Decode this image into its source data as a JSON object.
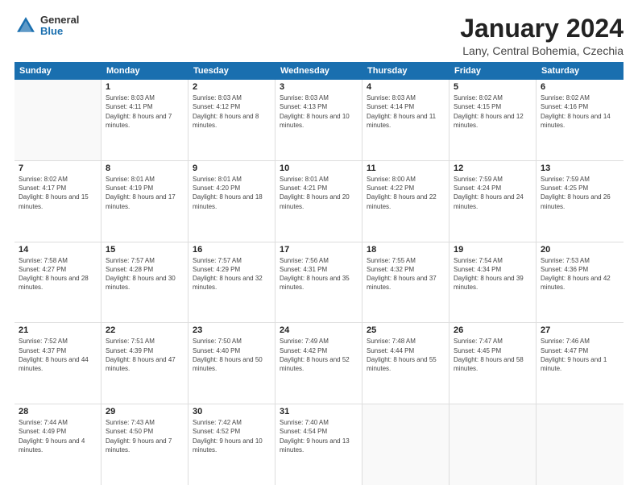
{
  "header": {
    "logo": {
      "general": "General",
      "blue": "Blue"
    },
    "title": "January 2024",
    "location": "Lany, Central Bohemia, Czechia"
  },
  "weekdays": [
    "Sunday",
    "Monday",
    "Tuesday",
    "Wednesday",
    "Thursday",
    "Friday",
    "Saturday"
  ],
  "weeks": [
    [
      {
        "day": "",
        "sunrise": "",
        "sunset": "",
        "daylight": ""
      },
      {
        "day": "1",
        "sunrise": "Sunrise: 8:03 AM",
        "sunset": "Sunset: 4:11 PM",
        "daylight": "Daylight: 8 hours and 7 minutes."
      },
      {
        "day": "2",
        "sunrise": "Sunrise: 8:03 AM",
        "sunset": "Sunset: 4:12 PM",
        "daylight": "Daylight: 8 hours and 8 minutes."
      },
      {
        "day": "3",
        "sunrise": "Sunrise: 8:03 AM",
        "sunset": "Sunset: 4:13 PM",
        "daylight": "Daylight: 8 hours and 10 minutes."
      },
      {
        "day": "4",
        "sunrise": "Sunrise: 8:03 AM",
        "sunset": "Sunset: 4:14 PM",
        "daylight": "Daylight: 8 hours and 11 minutes."
      },
      {
        "day": "5",
        "sunrise": "Sunrise: 8:02 AM",
        "sunset": "Sunset: 4:15 PM",
        "daylight": "Daylight: 8 hours and 12 minutes."
      },
      {
        "day": "6",
        "sunrise": "Sunrise: 8:02 AM",
        "sunset": "Sunset: 4:16 PM",
        "daylight": "Daylight: 8 hours and 14 minutes."
      }
    ],
    [
      {
        "day": "7",
        "sunrise": "Sunrise: 8:02 AM",
        "sunset": "Sunset: 4:17 PM",
        "daylight": "Daylight: 8 hours and 15 minutes."
      },
      {
        "day": "8",
        "sunrise": "Sunrise: 8:01 AM",
        "sunset": "Sunset: 4:19 PM",
        "daylight": "Daylight: 8 hours and 17 minutes."
      },
      {
        "day": "9",
        "sunrise": "Sunrise: 8:01 AM",
        "sunset": "Sunset: 4:20 PM",
        "daylight": "Daylight: 8 hours and 18 minutes."
      },
      {
        "day": "10",
        "sunrise": "Sunrise: 8:01 AM",
        "sunset": "Sunset: 4:21 PM",
        "daylight": "Daylight: 8 hours and 20 minutes."
      },
      {
        "day": "11",
        "sunrise": "Sunrise: 8:00 AM",
        "sunset": "Sunset: 4:22 PM",
        "daylight": "Daylight: 8 hours and 22 minutes."
      },
      {
        "day": "12",
        "sunrise": "Sunrise: 7:59 AM",
        "sunset": "Sunset: 4:24 PM",
        "daylight": "Daylight: 8 hours and 24 minutes."
      },
      {
        "day": "13",
        "sunrise": "Sunrise: 7:59 AM",
        "sunset": "Sunset: 4:25 PM",
        "daylight": "Daylight: 8 hours and 26 minutes."
      }
    ],
    [
      {
        "day": "14",
        "sunrise": "Sunrise: 7:58 AM",
        "sunset": "Sunset: 4:27 PM",
        "daylight": "Daylight: 8 hours and 28 minutes."
      },
      {
        "day": "15",
        "sunrise": "Sunrise: 7:57 AM",
        "sunset": "Sunset: 4:28 PM",
        "daylight": "Daylight: 8 hours and 30 minutes."
      },
      {
        "day": "16",
        "sunrise": "Sunrise: 7:57 AM",
        "sunset": "Sunset: 4:29 PM",
        "daylight": "Daylight: 8 hours and 32 minutes."
      },
      {
        "day": "17",
        "sunrise": "Sunrise: 7:56 AM",
        "sunset": "Sunset: 4:31 PM",
        "daylight": "Daylight: 8 hours and 35 minutes."
      },
      {
        "day": "18",
        "sunrise": "Sunrise: 7:55 AM",
        "sunset": "Sunset: 4:32 PM",
        "daylight": "Daylight: 8 hours and 37 minutes."
      },
      {
        "day": "19",
        "sunrise": "Sunrise: 7:54 AM",
        "sunset": "Sunset: 4:34 PM",
        "daylight": "Daylight: 8 hours and 39 minutes."
      },
      {
        "day": "20",
        "sunrise": "Sunrise: 7:53 AM",
        "sunset": "Sunset: 4:36 PM",
        "daylight": "Daylight: 8 hours and 42 minutes."
      }
    ],
    [
      {
        "day": "21",
        "sunrise": "Sunrise: 7:52 AM",
        "sunset": "Sunset: 4:37 PM",
        "daylight": "Daylight: 8 hours and 44 minutes."
      },
      {
        "day": "22",
        "sunrise": "Sunrise: 7:51 AM",
        "sunset": "Sunset: 4:39 PM",
        "daylight": "Daylight: 8 hours and 47 minutes."
      },
      {
        "day": "23",
        "sunrise": "Sunrise: 7:50 AM",
        "sunset": "Sunset: 4:40 PM",
        "daylight": "Daylight: 8 hours and 50 minutes."
      },
      {
        "day": "24",
        "sunrise": "Sunrise: 7:49 AM",
        "sunset": "Sunset: 4:42 PM",
        "daylight": "Daylight: 8 hours and 52 minutes."
      },
      {
        "day": "25",
        "sunrise": "Sunrise: 7:48 AM",
        "sunset": "Sunset: 4:44 PM",
        "daylight": "Daylight: 8 hours and 55 minutes."
      },
      {
        "day": "26",
        "sunrise": "Sunrise: 7:47 AM",
        "sunset": "Sunset: 4:45 PM",
        "daylight": "Daylight: 8 hours and 58 minutes."
      },
      {
        "day": "27",
        "sunrise": "Sunrise: 7:46 AM",
        "sunset": "Sunset: 4:47 PM",
        "daylight": "Daylight: 9 hours and 1 minute."
      }
    ],
    [
      {
        "day": "28",
        "sunrise": "Sunrise: 7:44 AM",
        "sunset": "Sunset: 4:49 PM",
        "daylight": "Daylight: 9 hours and 4 minutes."
      },
      {
        "day": "29",
        "sunrise": "Sunrise: 7:43 AM",
        "sunset": "Sunset: 4:50 PM",
        "daylight": "Daylight: 9 hours and 7 minutes."
      },
      {
        "day": "30",
        "sunrise": "Sunrise: 7:42 AM",
        "sunset": "Sunset: 4:52 PM",
        "daylight": "Daylight: 9 hours and 10 minutes."
      },
      {
        "day": "31",
        "sunrise": "Sunrise: 7:40 AM",
        "sunset": "Sunset: 4:54 PM",
        "daylight": "Daylight: 9 hours and 13 minutes."
      },
      {
        "day": "",
        "sunrise": "",
        "sunset": "",
        "daylight": ""
      },
      {
        "day": "",
        "sunrise": "",
        "sunset": "",
        "daylight": ""
      },
      {
        "day": "",
        "sunrise": "",
        "sunset": "",
        "daylight": ""
      }
    ]
  ]
}
